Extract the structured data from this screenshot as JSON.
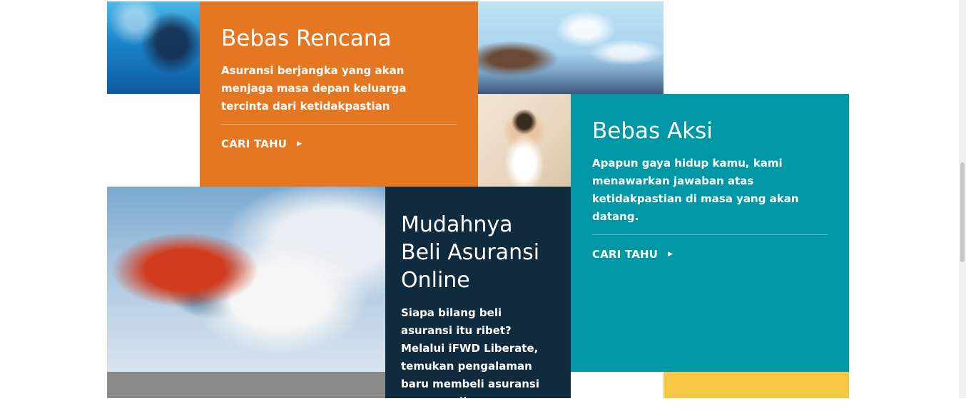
{
  "cards": {
    "rencana": {
      "title": "Bebas Rencana",
      "description": "Asuransi berjangka yang akan menjaga masa depan keluarga tercinta dari ketidakpastian",
      "cta_label": "CARI TAHU",
      "color": "#e67722"
    },
    "aksi": {
      "title": "Bebas Aksi",
      "description": "Apapun gaya hidup kamu, kami menawarkan jawaban atas ketidakpastian di masa yang akan datang.",
      "cta_label": "CARI TAHU",
      "color": "#0097a6"
    },
    "online": {
      "title": "Mudahnya Beli Asuransi Online",
      "description": "Siapa bilang beli asuransi itu ribet? Melalui iFWD Liberate, temukan pengalaman baru membeli asuransi secara online.",
      "color": "#0f2b3d"
    }
  },
  "icons": {
    "cta_arrow": "triangle-right-icon"
  },
  "accent_colors": {
    "gray_block": "#8a8a8a",
    "yellow_block": "#f6c844"
  }
}
